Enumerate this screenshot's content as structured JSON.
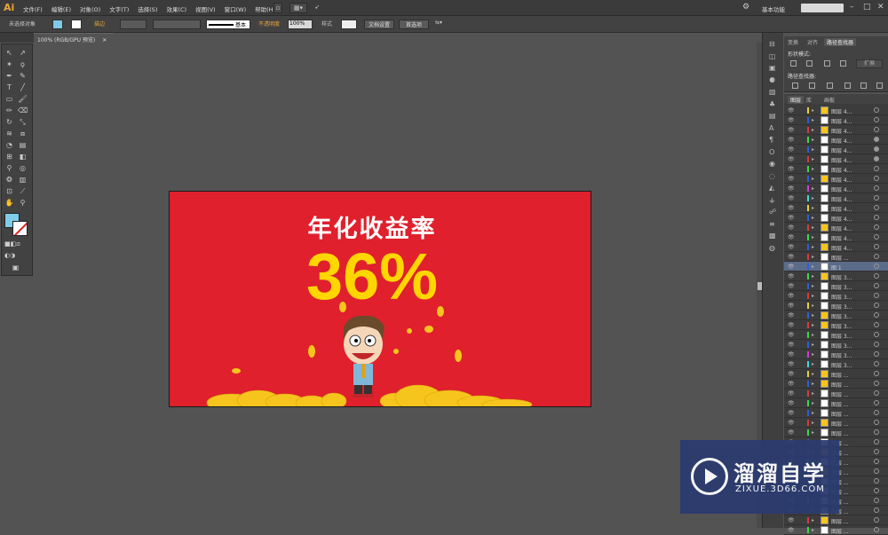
{
  "app": {
    "logo": "Ai",
    "workspace": "基本功能",
    "menus": [
      "文件(F)",
      "编辑(E)",
      "对象(O)",
      "文字(T)",
      "选择(S)",
      "效果(C)",
      "视图(V)",
      "窗口(W)",
      "帮助(H)"
    ]
  },
  "control_bar": {
    "selection": "未选择对象",
    "stroke_label": "描边",
    "stroke_profile": "基本",
    "opacity_label": "不透明度",
    "opacity_value": "100%",
    "style_label": "样式",
    "doc_setup": "文档设置",
    "preferences": "首选项"
  },
  "document_tab": {
    "label": "100% (RGB/GPU 预览)"
  },
  "artboard": {
    "headline": "年化收益率",
    "percent": "36%",
    "bg_color": "#e0202c",
    "headline_color": "#ffffff",
    "percent_color": "#ffd600"
  },
  "pathfinder": {
    "tabs": [
      "变换",
      "对齐",
      "路径查找器"
    ],
    "shape_modes": "形状模式:",
    "pathfinders": "路径查找器:",
    "expand": "扩展"
  },
  "layers": {
    "tabs": [
      "图层",
      "库",
      "画板"
    ],
    "rows": [
      {
        "name": "图层 4...",
        "color": "#e5d23a",
        "filled": false
      },
      {
        "name": "图层 4...",
        "color": "#2b5fd9",
        "filled": false
      },
      {
        "name": "图层 4...",
        "color": "#d93a3a",
        "filled": false
      },
      {
        "name": "图层 4...",
        "color": "#3ad94a",
        "filled": true
      },
      {
        "name": "图层 4...",
        "color": "#2b5fd9",
        "filled": true
      },
      {
        "name": "图层 4...",
        "color": "#d93a3a",
        "filled": true
      },
      {
        "name": "图层 4...",
        "color": "#3ad94a",
        "filled": false
      },
      {
        "name": "图层 4...",
        "color": "#2b5fd9",
        "filled": false
      },
      {
        "name": "图层 4...",
        "color": "#d93ad9",
        "filled": false
      },
      {
        "name": "图层 4...",
        "color": "#3ad9d9",
        "filled": false
      },
      {
        "name": "图层 4...",
        "color": "#e5d23a",
        "filled": false
      },
      {
        "name": "图层 4...",
        "color": "#2b5fd9",
        "filled": false
      },
      {
        "name": "图层 4...",
        "color": "#d93a3a",
        "filled": false
      },
      {
        "name": "图层 4...",
        "color": "#3ad94a",
        "filled": false
      },
      {
        "name": "图层 4...",
        "color": "#2b5fd9",
        "filled": false
      },
      {
        "name": "图层 ...",
        "color": "#d93a3a",
        "filled": false
      },
      {
        "name": "图 1",
        "color": "#2b5fd9",
        "filled": false,
        "selected": true
      },
      {
        "name": "图层 3...",
        "color": "#3ad94a",
        "filled": false
      },
      {
        "name": "图层 3...",
        "color": "#2b5fd9",
        "filled": false
      },
      {
        "name": "图层 3...",
        "color": "#d93a3a",
        "filled": false
      },
      {
        "name": "图层 3...",
        "color": "#e5d23a",
        "filled": false
      },
      {
        "name": "图层 3...",
        "color": "#2b5fd9",
        "filled": false
      },
      {
        "name": "图层 3...",
        "color": "#d93a3a",
        "filled": false
      },
      {
        "name": "图层 3...",
        "color": "#3ad94a",
        "filled": false
      },
      {
        "name": "图层 3...",
        "color": "#2b5fd9",
        "filled": false
      },
      {
        "name": "图层 3...",
        "color": "#d93ad9",
        "filled": false
      },
      {
        "name": "图层 3...",
        "color": "#3ad9d9",
        "filled": false
      },
      {
        "name": "图层 ...",
        "color": "#e5d23a",
        "filled": false
      },
      {
        "name": "图层 ...",
        "color": "#2b5fd9",
        "filled": false
      },
      {
        "name": "图层 ...",
        "color": "#d93a3a",
        "filled": false
      },
      {
        "name": "图层 ...",
        "color": "#3ad94a",
        "filled": false
      },
      {
        "name": "图层 ...",
        "color": "#2b5fd9",
        "filled": false
      },
      {
        "name": "图层 ...",
        "color": "#d93a3a",
        "filled": false
      },
      {
        "name": "图层 ...",
        "color": "#3ad94a",
        "filled": false
      },
      {
        "name": "图层 ...",
        "color": "#2b5fd9",
        "filled": false
      },
      {
        "name": "图层 ...",
        "color": "#d93ad9",
        "filled": false
      },
      {
        "name": "图层 ...",
        "color": "#3ad9d9",
        "filled": false
      },
      {
        "name": "图层 ...",
        "color": "#e5d23a",
        "filled": false
      },
      {
        "name": "图层 ...",
        "color": "#2b5fd9",
        "filled": false
      },
      {
        "name": "图层 ...",
        "color": "#d93a3a",
        "filled": false
      },
      {
        "name": "图层 ...",
        "color": "#3ad94a",
        "filled": false
      },
      {
        "name": "图层 ...",
        "color": "#2b5fd9",
        "filled": false
      },
      {
        "name": "图层 ...",
        "color": "#d93a3a",
        "filled": false
      },
      {
        "name": "图层 ...",
        "color": "#3ad94a",
        "filled": false
      }
    ]
  },
  "watermark": {
    "title": "溜溜自学",
    "subtitle": "ZIXUE.3D66.COM"
  }
}
